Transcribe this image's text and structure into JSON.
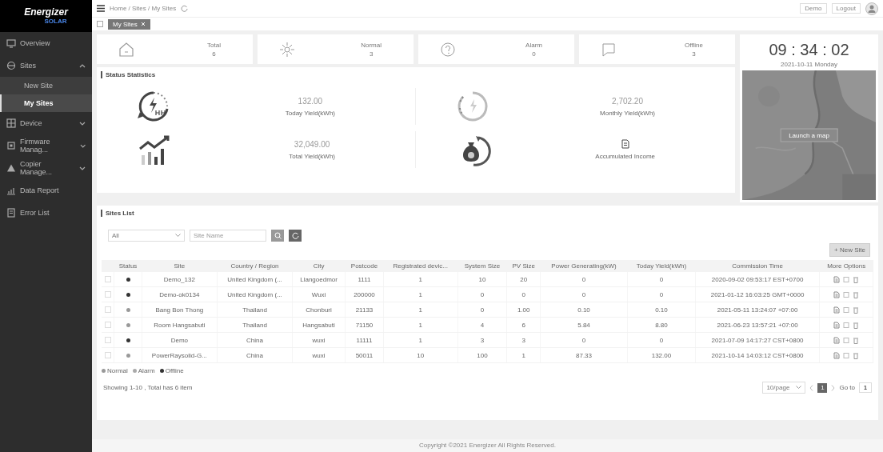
{
  "sidebar": {
    "logo": "Energizer",
    "logo_sub": "SOLAR",
    "items": [
      {
        "label": "Overview",
        "selected": false
      },
      {
        "label": "Sites",
        "selected": false,
        "expanded": true,
        "children": [
          {
            "label": "New Site",
            "selected": false
          },
          {
            "label": "My Sites",
            "selected": true
          }
        ]
      },
      {
        "label": "Device",
        "selected": false,
        "expanded": false
      },
      {
        "label": "Firmware Manag...",
        "selected": false,
        "expanded": false
      },
      {
        "label": "Copier Manage...",
        "selected": false,
        "expanded": false
      },
      {
        "label": "Data Report",
        "selected": false
      },
      {
        "label": "Error List",
        "selected": false
      }
    ]
  },
  "header": {
    "breadcrumb": "Home / Sites / My Sites",
    "actions": [
      "Demo",
      "Logout"
    ],
    "tabs": [
      {
        "label": "My Sites",
        "selected": true
      }
    ]
  },
  "summary": [
    {
      "kind": "total",
      "label": "Total",
      "value": "6"
    },
    {
      "kind": "normal",
      "label": "Normal",
      "value": "3"
    },
    {
      "kind": "alarm",
      "label": "Alarm",
      "value": "0"
    },
    {
      "kind": "offline",
      "label": "Offline",
      "value": "3"
    }
  ],
  "clock": {
    "time": "09 : 34 : 02",
    "date": "2021-10-11 Monday",
    "map_button": "Launch a map"
  },
  "statistics": {
    "title": "Status Statistics",
    "items": [
      {
        "kind": "today",
        "value": "132.00",
        "label": "Today Yield(kWh)"
      },
      {
        "kind": "monthly",
        "value": "2,702.20",
        "label": "Monthly Yield(kWh)"
      },
      {
        "kind": "total",
        "value": "32,049.00",
        "label": "Total Yield(kWh)"
      },
      {
        "kind": "income",
        "label": "Accumulated Income"
      }
    ]
  },
  "sites": {
    "title": "Sites List",
    "filter": {
      "value": "All"
    },
    "search": {
      "placeholder": "Site Name"
    },
    "new_button": "+ New Site",
    "columns": [
      "",
      "Status",
      "Site",
      "Country / Region",
      "City",
      "Postcode",
      "Registrated devic...",
      "System Size",
      "PV Size",
      "Power Generating(kW)",
      "Today Yield(kWh)",
      "Commission Time",
      "More Options"
    ],
    "rows": [
      {
        "checked": false,
        "color": "#333333",
        "cells": [
          "",
          "",
          "Demo_132",
          "United Kingdom (...",
          "Llangoedmor",
          "1111",
          "1",
          "10",
          "20",
          "0",
          "0",
          "2020-09-02 09:53:17 EST+0700",
          ""
        ]
      },
      {
        "checked": false,
        "color": "#333333",
        "cells": [
          "",
          "",
          "Demo-ok0134",
          "United Kingdom (...",
          "Wuxi",
          "200000",
          "1",
          "0",
          "0",
          "0",
          "0",
          "2021-01-12 16:03:25 GMT+0000",
          ""
        ]
      },
      {
        "checked": false,
        "color": "#999999",
        "cells": [
          "",
          "",
          "Bang Bon Thong",
          "Thailand",
          "Chonburi",
          "21133",
          "1",
          "0",
          "1.00",
          "0.10",
          "0.10",
          "2021-05-11 13:24:07 +07:00",
          ""
        ]
      },
      {
        "checked": false,
        "color": "#999999",
        "cells": [
          "",
          "",
          "Room Hangsabuti",
          "Thailand",
          "Hangsabuti",
          "71150",
          "1",
          "4",
          "6",
          "5.84",
          "8.80",
          "2021-06-23 13:57:21 +07:00",
          ""
        ]
      },
      {
        "checked": false,
        "color": "#333333",
        "cells": [
          "",
          "",
          "Demo",
          "China",
          "wuxi",
          "11111",
          "1",
          "3",
          "3",
          "0",
          "0",
          "2021-07-09 14:17:27 CST+0800",
          ""
        ]
      },
      {
        "checked": false,
        "color": "#999999",
        "cells": [
          "",
          "",
          "PowerRaysolid-G...",
          "China",
          "wuxi",
          "50011",
          "10",
          "100",
          "1",
          "87.33",
          "132.00",
          "2021-10-14 14:03:12 CST+0800",
          ""
        ]
      }
    ],
    "legend": [
      {
        "label": "Normal",
        "color": "#999999"
      },
      {
        "label": "Alarm",
        "color": "#aaaaaa"
      },
      {
        "label": "Offline",
        "color": "#333333"
      }
    ],
    "summary": "Showing 1-10 , Total has 6 item",
    "pagination": {
      "page_size": "10/page",
      "pages": [
        {
          "label": "1",
          "selected": true
        }
      ],
      "goto_label": "Go to",
      "goto_value": "1"
    }
  },
  "footer": "Copyright ©2021 Energizer All Rights Reserved."
}
